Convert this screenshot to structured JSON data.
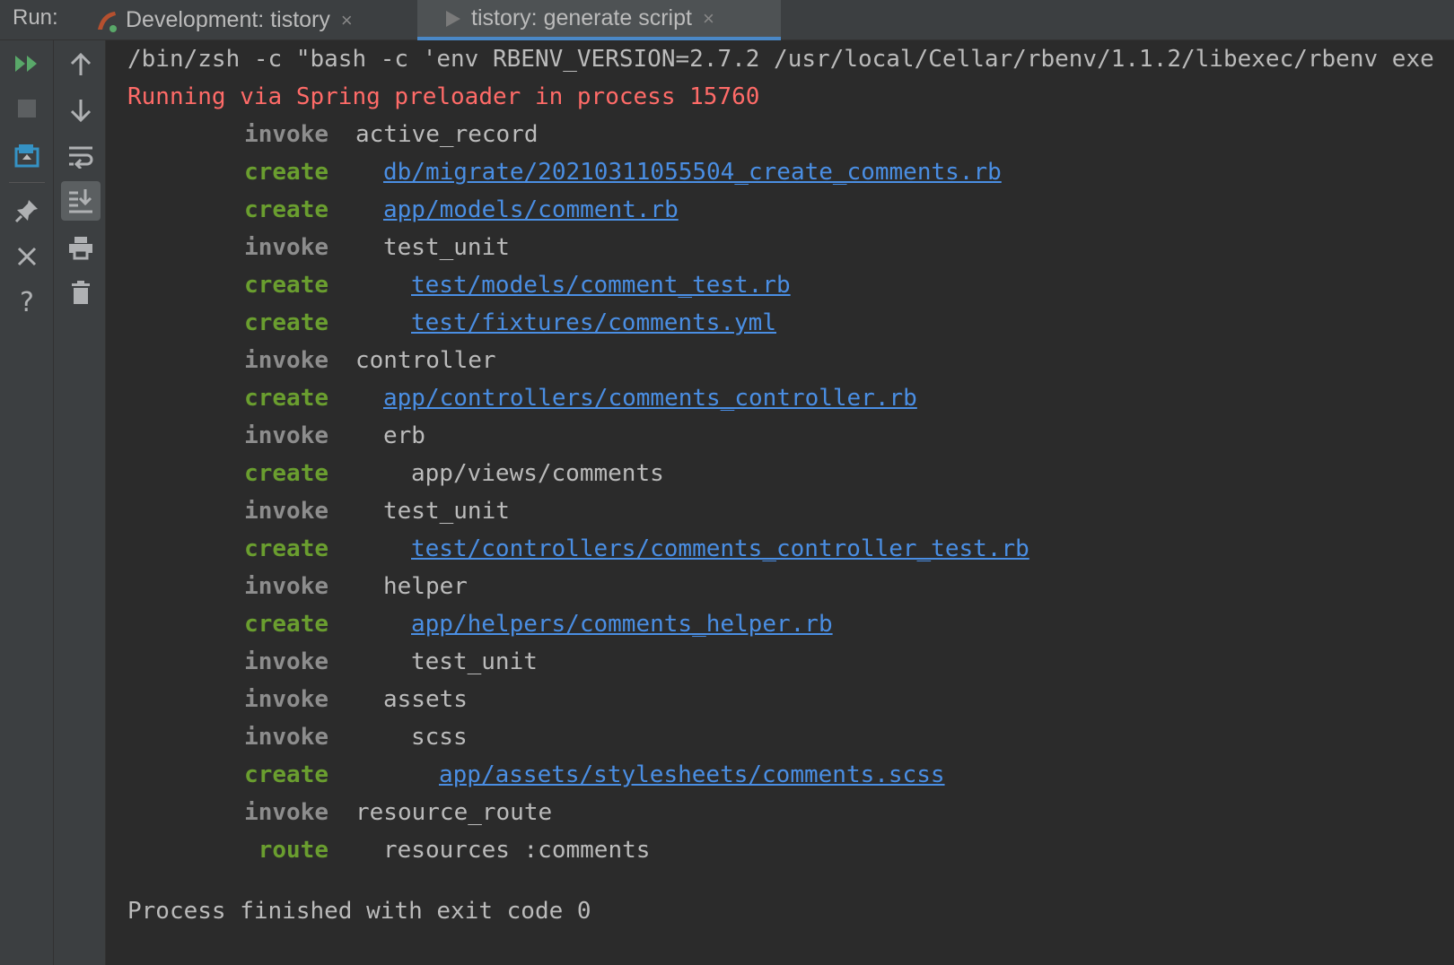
{
  "tabbar": {
    "run_label": "Run:",
    "tab1_label": "Development: tistory",
    "tab2_label": "tistory: generate script",
    "close_glyph": "×"
  },
  "toolbar_left": [
    "rerun-icon",
    "stop-icon",
    "restore-layout-icon",
    "pin-icon",
    "close-icon",
    "help-icon"
  ],
  "toolbar_right": [
    "up-arrow-icon",
    "down-arrow-icon",
    "soft-wrap-icon",
    "scroll-to-end-icon",
    "print-icon",
    "trash-icon"
  ],
  "console": {
    "command": "/bin/zsh -c \"bash -c 'env RBENV_VERSION=2.7.2 /usr/local/Cellar/rbenv/1.1.2/libexec/rbenv exe",
    "spring": "Running via Spring preloader in process 15760",
    "lines": [
      {
        "kw": "invoke",
        "indent": 0,
        "text": "active_record",
        "link": false
      },
      {
        "kw": "create",
        "indent": 1,
        "text": "db/migrate/20210311055504_create_comments.rb",
        "link": true
      },
      {
        "kw": "create",
        "indent": 1,
        "text": "app/models/comment.rb",
        "link": true
      },
      {
        "kw": "invoke",
        "indent": 1,
        "text": "test_unit",
        "link": false
      },
      {
        "kw": "create",
        "indent": 2,
        "text": "test/models/comment_test.rb",
        "link": true
      },
      {
        "kw": "create",
        "indent": 2,
        "text": "test/fixtures/comments.yml",
        "link": true
      },
      {
        "kw": "invoke",
        "indent": 0,
        "text": "controller",
        "link": false
      },
      {
        "kw": "create",
        "indent": 1,
        "text": "app/controllers/comments_controller.rb",
        "link": true
      },
      {
        "kw": "invoke",
        "indent": 1,
        "text": "erb",
        "link": false
      },
      {
        "kw": "create",
        "indent": 2,
        "text": "app/views/comments",
        "link": false
      },
      {
        "kw": "invoke",
        "indent": 1,
        "text": "test_unit",
        "link": false
      },
      {
        "kw": "create",
        "indent": 2,
        "text": "test/controllers/comments_controller_test.rb",
        "link": true
      },
      {
        "kw": "invoke",
        "indent": 1,
        "text": "helper",
        "link": false
      },
      {
        "kw": "create",
        "indent": 2,
        "text": "app/helpers/comments_helper.rb",
        "link": true
      },
      {
        "kw": "invoke",
        "indent": 2,
        "text": "test_unit",
        "link": false
      },
      {
        "kw": "invoke",
        "indent": 1,
        "text": "assets",
        "link": false
      },
      {
        "kw": "invoke",
        "indent": 2,
        "text": "scss",
        "link": false
      },
      {
        "kw": "create",
        "indent": 3,
        "text": "app/assets/stylesheets/comments.scss",
        "link": true
      },
      {
        "kw": "invoke",
        "indent": 0,
        "text": "resource_route",
        "link": false
      },
      {
        "kw": "route",
        "indent": 1,
        "text": "resources :comments",
        "link": false
      }
    ],
    "finished": "Process finished with exit code 0"
  },
  "colors": {
    "background": "#2b2b2b",
    "panel": "#3c3f41",
    "invoke": "#8d8d8d",
    "create": "#6a9e2f",
    "link": "#4a8ee3",
    "error": "#ff6b68",
    "run_green": "#59a869"
  }
}
